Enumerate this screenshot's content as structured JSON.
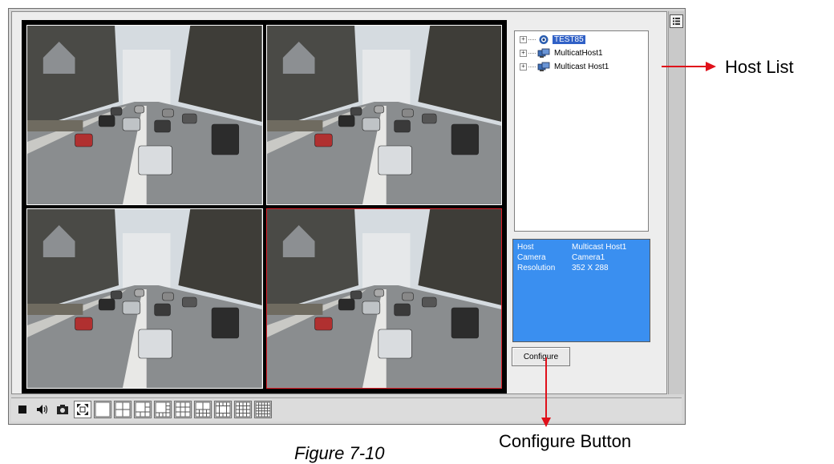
{
  "host_list": {
    "items": [
      {
        "label": "TEST85",
        "selected": true,
        "icon": "camera-host-icon"
      },
      {
        "label": "MulticatHost1",
        "selected": false,
        "icon": "network-host-icon"
      },
      {
        "label": "Multicast Host1",
        "selected": false,
        "icon": "network-host-icon"
      }
    ]
  },
  "info": {
    "rows": [
      {
        "key": "Host",
        "value": "Multicast Host1"
      },
      {
        "key": "Camera",
        "value": "Camera1"
      },
      {
        "key": "Resolution",
        "value": "352 X 288"
      }
    ]
  },
  "configure_label": "Configure",
  "toolbar_icons": [
    "stop-icon",
    "volume-icon",
    "snapshot-icon",
    "fullscreen-icon",
    "layout-1-icon",
    "layout-4-icon",
    "layout-6-icon",
    "layout-8-icon",
    "layout-9-icon",
    "layout-10-icon",
    "layout-13-icon",
    "layout-16-icon",
    "layout-25-icon"
  ],
  "annotations": {
    "host_list": "Host List",
    "configure_button": "Configure Button",
    "figure": "Figure 7-10"
  },
  "colors": {
    "selection": "#3161c6",
    "info_panel": "#3a8ff0",
    "selected_frame": "#e0202a",
    "callout": "#e0101a"
  }
}
